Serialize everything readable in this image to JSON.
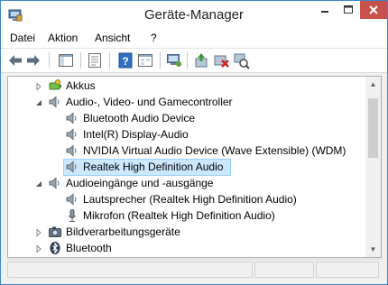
{
  "window": {
    "title": "Geräte-Manager"
  },
  "menu": {
    "items": [
      "Datei",
      "Aktion",
      "Ansicht",
      "?"
    ]
  },
  "colors": {
    "selection_bg": "#cce8ff",
    "close_button": "#c7504a",
    "window_border": "#3a86c8"
  },
  "toolbar": {
    "icons": [
      "back-arrow-icon",
      "forward-arrow-icon",
      "show-hide-console-tree-icon",
      "properties-icon",
      "help-icon",
      "view-icon",
      "computer-monitor-icon",
      "update-driver-icon",
      "uninstall-device-icon",
      "scan-hardware-icon"
    ]
  },
  "tree": {
    "items": [
      {
        "label": "Akkus",
        "level": 0,
        "expander": "collapsed",
        "icon": "battery-icon"
      },
      {
        "label": "Audio-, Video- und Gamecontroller",
        "level": 0,
        "expander": "expanded",
        "icon": "speaker-icon"
      },
      {
        "label": "Bluetooth Audio Device",
        "level": 1,
        "icon": "speaker-icon"
      },
      {
        "label": "Intel(R) Display-Audio",
        "level": 1,
        "icon": "speaker-icon"
      },
      {
        "label": "NVIDIA Virtual Audio Device (Wave Extensible) (WDM)",
        "level": 1,
        "icon": "speaker-icon"
      },
      {
        "label": "Realtek High Definition Audio",
        "level": 1,
        "icon": "speaker-icon",
        "selected": true
      },
      {
        "label": "Audioeingänge und -ausgänge",
        "level": 0,
        "expander": "expanded",
        "icon": "speaker-icon"
      },
      {
        "label": "Lautsprecher (Realtek High Definition Audio)",
        "level": 1,
        "icon": "speaker-icon"
      },
      {
        "label": "Mikrofon (Realtek High Definition Audio)",
        "level": 1,
        "icon": "microphone-icon"
      },
      {
        "label": "Bildverarbeitungsgeräte",
        "level": 0,
        "expander": "collapsed",
        "icon": "camera-icon"
      },
      {
        "label": "Bluetooth",
        "level": 0,
        "expander": "collapsed",
        "icon": "bluetooth-icon"
      }
    ]
  }
}
